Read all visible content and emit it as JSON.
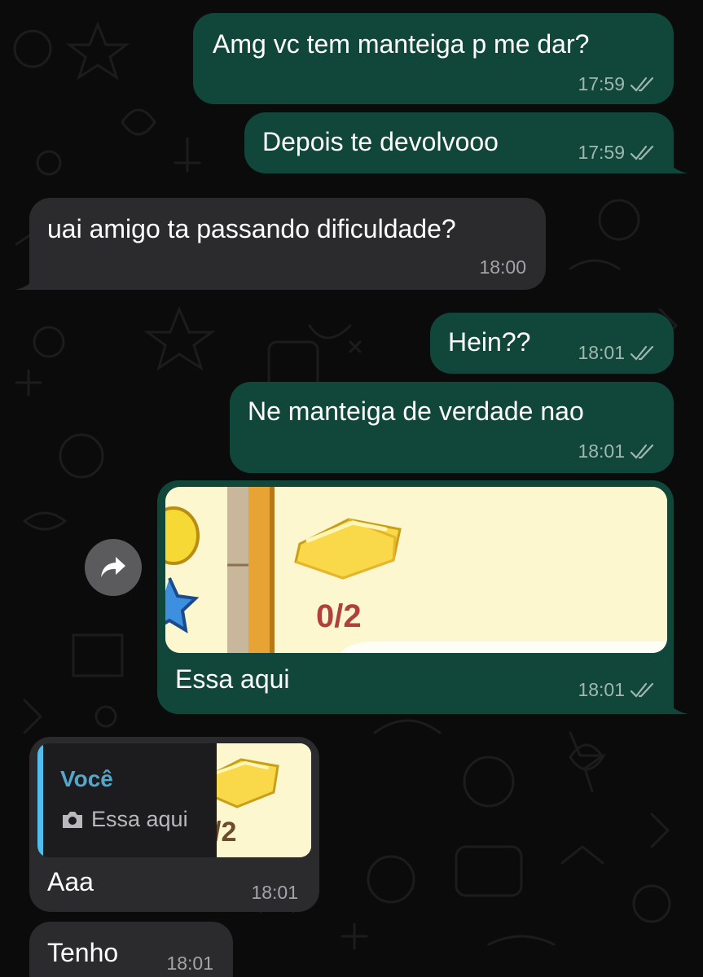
{
  "messages": [
    {
      "text": "Amg vc tem manteiga p me dar?",
      "time": "17:59"
    },
    {
      "text": "Depois te devolvooo",
      "time": "17:59"
    },
    {
      "text": "uai amigo ta passando dificuldade?",
      "time": "18:00"
    },
    {
      "text": "Hein??",
      "time": "18:01"
    },
    {
      "text": "Ne manteiga de verdade nao",
      "time": "18:01"
    },
    {
      "text": "Essa aqui",
      "time": "18:01",
      "image_counter": "0/2"
    },
    {
      "text": "Aaa",
      "time": "18:01",
      "reply": {
        "author": "Você",
        "text": "Essa aqui",
        "thumb_text": "/2"
      }
    },
    {
      "text": "Tenho",
      "time": "18:01"
    }
  ],
  "colors": {
    "outgoing_bubble": "#11473a",
    "incoming_bubble": "#2b2b2d",
    "background": "#0b0b0b",
    "reply_accent": "#53bdeb"
  },
  "icons": {
    "read_receipt": "double-check-icon",
    "forward": "forward-arrow-icon",
    "photo": "camera-icon"
  }
}
